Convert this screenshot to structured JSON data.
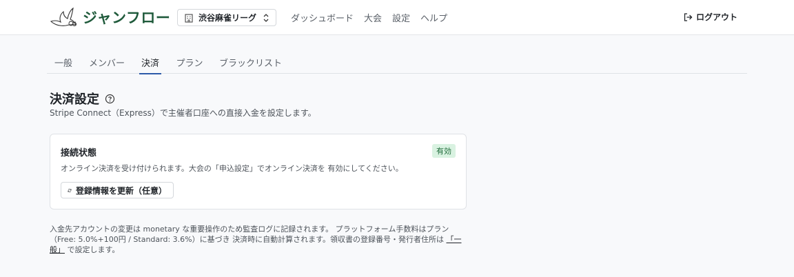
{
  "app": {
    "title": "ジャンフロー",
    "logo_icon": "dove-icon",
    "brand_color": "#1f5a3b"
  },
  "header": {
    "org_select": {
      "value": "渋谷麻雀リーグ",
      "icon": "building-icon"
    },
    "nav": [
      {
        "label": "ダッシュボード"
      },
      {
        "label": "大会"
      },
      {
        "label": "設定"
      },
      {
        "label": "ヘルプ"
      }
    ],
    "logout_label": "ログアウト"
  },
  "tabs": [
    {
      "label": "一般",
      "active": false
    },
    {
      "label": "メンバー",
      "active": false
    },
    {
      "label": "決済",
      "active": true
    },
    {
      "label": "プラン",
      "active": false
    },
    {
      "label": "ブラックリスト",
      "active": false
    }
  ],
  "section": {
    "title": "決済設定",
    "subtitle": "Stripe Connect（Express）で主催者口座への直接入金を設定します。"
  },
  "connection": {
    "title": "接続状態",
    "badge": "有効",
    "badge_color": "#d9f2e1",
    "description": "オンライン決済を受け付けられます。大会の「申込設定」でオンライン決済を 有効にしてください。",
    "button_label": "登録情報を更新（任意）"
  },
  "footnote": {
    "text": "入金先アカウントの変更は monetary な重要操作のため監査ログに記録されます。 プラットフォーム手数料はプラン（Free: 5.0%+100円 / Standard: 3.6%）に基づき 決済時に自動計算されます。領収書の登録番号・発行者住所は ",
    "link_label": "「一般」",
    "suffix": " で設定します。"
  }
}
